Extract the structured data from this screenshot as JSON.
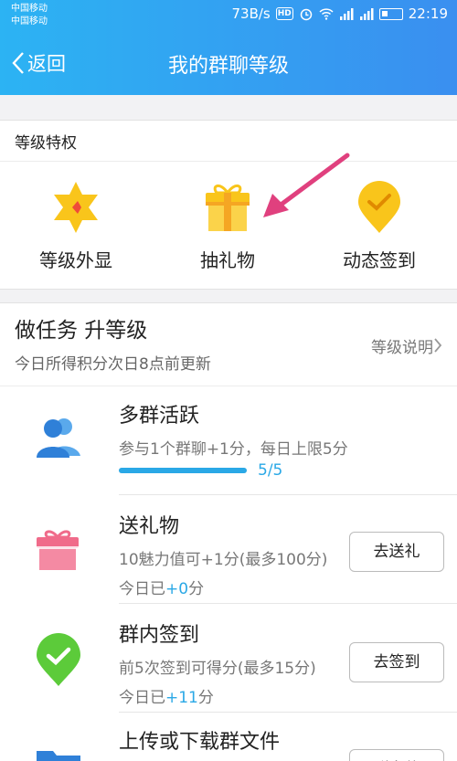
{
  "status_bar": {
    "carrier_1": "中国移动",
    "carrier_2": "中国移动",
    "speed": "73B/s",
    "hd": "HD",
    "time": "22:19"
  },
  "nav": {
    "back_label": "返回",
    "title": "我的群聊等级"
  },
  "privileges": {
    "section_title": "等级特权",
    "items": [
      {
        "label": "等级外显",
        "icon": "star-badge-icon"
      },
      {
        "label": "抽礼物",
        "icon": "gift-icon"
      },
      {
        "label": "动态签到",
        "icon": "location-check-icon"
      }
    ]
  },
  "tasks": {
    "title": "做任务 升等级",
    "subtitle": "今日所得积分次日8点前更新",
    "level_desc": "等级说明",
    "items": [
      {
        "title": "多群活跃",
        "desc": "参与1个群聊+1分，每日上限5分",
        "progress": 1.0,
        "progress_text": "5/5",
        "icon": "users-icon"
      },
      {
        "title": "送礼物",
        "desc": "10魅力值可+1分(最多100分)",
        "today_prefix": "今日已",
        "today_points": "+0",
        "today_suffix": "分",
        "button": "去送礼",
        "icon": "gift-icon"
      },
      {
        "title": "群内签到",
        "desc": "前5次签到可得分(最多15分)",
        "today_prefix": "今日已",
        "today_points": "+11",
        "today_suffix": "分",
        "button": "去签到",
        "icon": "checkin-icon"
      },
      {
        "title": "上传或下载群文件",
        "button": "群文件",
        "icon": "folder-icon"
      }
    ]
  },
  "colors": {
    "header_start": "#2cb3f3",
    "header_end": "#3a8ff0",
    "accent_blue": "#2aa8e6",
    "gift_pink": "#f06b8a",
    "checkin_green": "#5ccb3a",
    "privilege_yellow": "#f9c51b",
    "arrow_pink": "#e0407e"
  }
}
